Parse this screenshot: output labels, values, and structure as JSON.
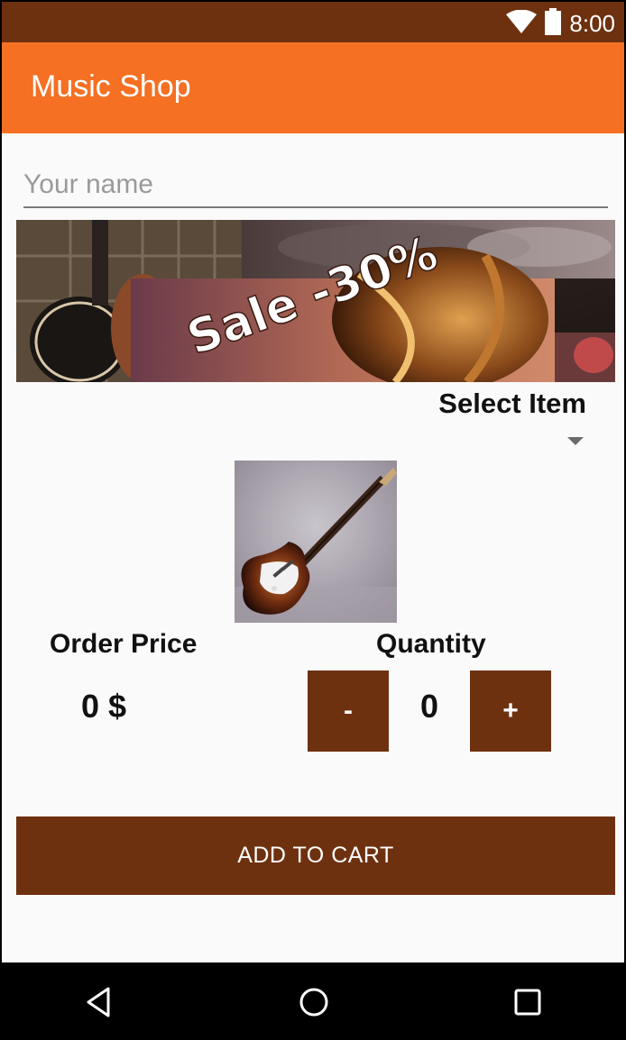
{
  "status_bar": {
    "time": "8:00"
  },
  "app_bar": {
    "title": "Music Shop"
  },
  "form": {
    "name_placeholder": "Your name",
    "name_value": ""
  },
  "banner": {
    "sale_text": "Sale -30%"
  },
  "item_select": {
    "label": "Select Item"
  },
  "order": {
    "price_label": "Order Price",
    "price_value": "0 $"
  },
  "quantity": {
    "label": "Quantity",
    "minus_label": "-",
    "plus_label": "+",
    "value": "0"
  },
  "cart": {
    "button_label": "ADD TO CART"
  },
  "colors": {
    "primary": "#f57023",
    "primary_dark": "#6e3110",
    "accent_buttons": "#6e3110",
    "background": "#fafafa"
  }
}
